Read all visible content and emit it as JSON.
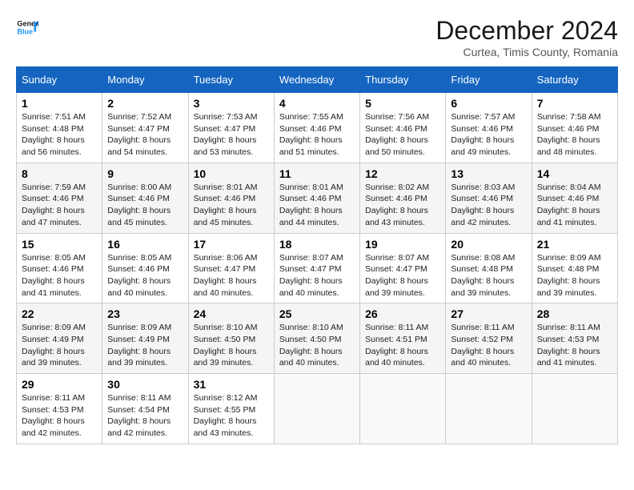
{
  "header": {
    "logo_line1": "General",
    "logo_line2": "Blue",
    "month_year": "December 2024",
    "location": "Curtea, Timis County, Romania"
  },
  "weekdays": [
    "Sunday",
    "Monday",
    "Tuesday",
    "Wednesday",
    "Thursday",
    "Friday",
    "Saturday"
  ],
  "weeks": [
    [
      {
        "day": "1",
        "sunrise": "7:51 AM",
        "sunset": "4:48 PM",
        "daylight": "8 hours and 56 minutes."
      },
      {
        "day": "2",
        "sunrise": "7:52 AM",
        "sunset": "4:47 PM",
        "daylight": "8 hours and 54 minutes."
      },
      {
        "day": "3",
        "sunrise": "7:53 AM",
        "sunset": "4:47 PM",
        "daylight": "8 hours and 53 minutes."
      },
      {
        "day": "4",
        "sunrise": "7:55 AM",
        "sunset": "4:46 PM",
        "daylight": "8 hours and 51 minutes."
      },
      {
        "day": "5",
        "sunrise": "7:56 AM",
        "sunset": "4:46 PM",
        "daylight": "8 hours and 50 minutes."
      },
      {
        "day": "6",
        "sunrise": "7:57 AM",
        "sunset": "4:46 PM",
        "daylight": "8 hours and 49 minutes."
      },
      {
        "day": "7",
        "sunrise": "7:58 AM",
        "sunset": "4:46 PM",
        "daylight": "8 hours and 48 minutes."
      }
    ],
    [
      {
        "day": "8",
        "sunrise": "7:59 AM",
        "sunset": "4:46 PM",
        "daylight": "8 hours and 47 minutes."
      },
      {
        "day": "9",
        "sunrise": "8:00 AM",
        "sunset": "4:46 PM",
        "daylight": "8 hours and 45 minutes."
      },
      {
        "day": "10",
        "sunrise": "8:01 AM",
        "sunset": "4:46 PM",
        "daylight": "8 hours and 45 minutes."
      },
      {
        "day": "11",
        "sunrise": "8:01 AM",
        "sunset": "4:46 PM",
        "daylight": "8 hours and 44 minutes."
      },
      {
        "day": "12",
        "sunrise": "8:02 AM",
        "sunset": "4:46 PM",
        "daylight": "8 hours and 43 minutes."
      },
      {
        "day": "13",
        "sunrise": "8:03 AM",
        "sunset": "4:46 PM",
        "daylight": "8 hours and 42 minutes."
      },
      {
        "day": "14",
        "sunrise": "8:04 AM",
        "sunset": "4:46 PM",
        "daylight": "8 hours and 41 minutes."
      }
    ],
    [
      {
        "day": "15",
        "sunrise": "8:05 AM",
        "sunset": "4:46 PM",
        "daylight": "8 hours and 41 minutes."
      },
      {
        "day": "16",
        "sunrise": "8:05 AM",
        "sunset": "4:46 PM",
        "daylight": "8 hours and 40 minutes."
      },
      {
        "day": "17",
        "sunrise": "8:06 AM",
        "sunset": "4:47 PM",
        "daylight": "8 hours and 40 minutes."
      },
      {
        "day": "18",
        "sunrise": "8:07 AM",
        "sunset": "4:47 PM",
        "daylight": "8 hours and 40 minutes."
      },
      {
        "day": "19",
        "sunrise": "8:07 AM",
        "sunset": "4:47 PM",
        "daylight": "8 hours and 39 minutes."
      },
      {
        "day": "20",
        "sunrise": "8:08 AM",
        "sunset": "4:48 PM",
        "daylight": "8 hours and 39 minutes."
      },
      {
        "day": "21",
        "sunrise": "8:09 AM",
        "sunset": "4:48 PM",
        "daylight": "8 hours and 39 minutes."
      }
    ],
    [
      {
        "day": "22",
        "sunrise": "8:09 AM",
        "sunset": "4:49 PM",
        "daylight": "8 hours and 39 minutes."
      },
      {
        "day": "23",
        "sunrise": "8:09 AM",
        "sunset": "4:49 PM",
        "daylight": "8 hours and 39 minutes."
      },
      {
        "day": "24",
        "sunrise": "8:10 AM",
        "sunset": "4:50 PM",
        "daylight": "8 hours and 39 minutes."
      },
      {
        "day": "25",
        "sunrise": "8:10 AM",
        "sunset": "4:50 PM",
        "daylight": "8 hours and 40 minutes."
      },
      {
        "day": "26",
        "sunrise": "8:11 AM",
        "sunset": "4:51 PM",
        "daylight": "8 hours and 40 minutes."
      },
      {
        "day": "27",
        "sunrise": "8:11 AM",
        "sunset": "4:52 PM",
        "daylight": "8 hours and 40 minutes."
      },
      {
        "day": "28",
        "sunrise": "8:11 AM",
        "sunset": "4:53 PM",
        "daylight": "8 hours and 41 minutes."
      }
    ],
    [
      {
        "day": "29",
        "sunrise": "8:11 AM",
        "sunset": "4:53 PM",
        "daylight": "8 hours and 42 minutes."
      },
      {
        "day": "30",
        "sunrise": "8:11 AM",
        "sunset": "4:54 PM",
        "daylight": "8 hours and 42 minutes."
      },
      {
        "day": "31",
        "sunrise": "8:12 AM",
        "sunset": "4:55 PM",
        "daylight": "8 hours and 43 minutes."
      },
      null,
      null,
      null,
      null
    ]
  ],
  "labels": {
    "sunrise_prefix": "Sunrise: ",
    "sunset_prefix": "Sunset: ",
    "daylight_label": "Daylight: "
  }
}
